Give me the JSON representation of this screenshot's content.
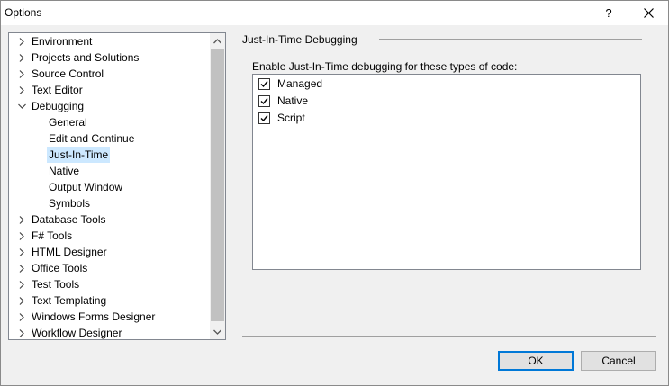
{
  "window": {
    "title": "Options",
    "help_glyph": "?"
  },
  "tree": {
    "items": [
      {
        "label": "Environment",
        "level": 0,
        "state": "collapsed"
      },
      {
        "label": "Projects and Solutions",
        "level": 0,
        "state": "collapsed"
      },
      {
        "label": "Source Control",
        "level": 0,
        "state": "collapsed"
      },
      {
        "label": "Text Editor",
        "level": 0,
        "state": "collapsed"
      },
      {
        "label": "Debugging",
        "level": 0,
        "state": "expanded"
      },
      {
        "label": "General",
        "level": 1
      },
      {
        "label": "Edit and Continue",
        "level": 1
      },
      {
        "label": "Just-In-Time",
        "level": 1,
        "selected": true
      },
      {
        "label": "Native",
        "level": 1
      },
      {
        "label": "Output Window",
        "level": 1
      },
      {
        "label": "Symbols",
        "level": 1
      },
      {
        "label": "Database Tools",
        "level": 0,
        "state": "collapsed"
      },
      {
        "label": "F# Tools",
        "level": 0,
        "state": "collapsed"
      },
      {
        "label": "HTML Designer",
        "level": 0,
        "state": "collapsed"
      },
      {
        "label": "Office Tools",
        "level": 0,
        "state": "collapsed"
      },
      {
        "label": "Test Tools",
        "level": 0,
        "state": "collapsed"
      },
      {
        "label": "Text Templating",
        "level": 0,
        "state": "collapsed"
      },
      {
        "label": "Windows Forms Designer",
        "level": 0,
        "state": "collapsed"
      },
      {
        "label": "Workflow Designer",
        "level": 0,
        "state": "collapsed"
      }
    ]
  },
  "page": {
    "section_title": "Just-In-Time Debugging",
    "prompt": "Enable Just-In-Time debugging for these types of code:",
    "options": [
      {
        "label": "Managed",
        "checked": true
      },
      {
        "label": "Native",
        "checked": true
      },
      {
        "label": "Script",
        "checked": true
      }
    ]
  },
  "buttons": {
    "ok": "OK",
    "cancel": "Cancel"
  },
  "colors": {
    "selection": "#cce8ff",
    "default_button_border": "#0078d7"
  }
}
